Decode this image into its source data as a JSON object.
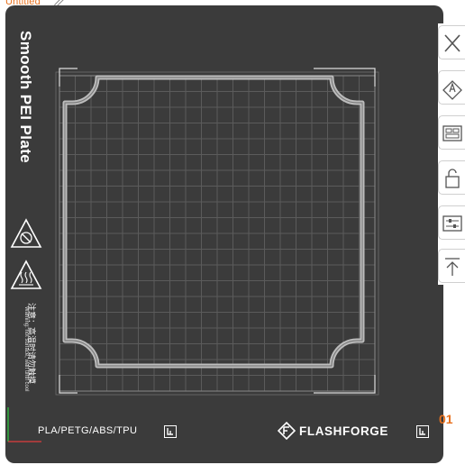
{
  "app": {
    "title": "Untitled"
  },
  "plate": {
    "name": "Smooth PEI Plate",
    "warning_cn": "注意：高温时请勿触摸",
    "warning_en": "Warning: hot surface, wait until cool",
    "materials": "PLA/PETG/ABS/TPU",
    "brand": "FLASHFORGE",
    "number": "01"
  },
  "toolbar": {
    "items": [
      {
        "icon": "close-icon"
      },
      {
        "icon": "auto-orient-icon"
      },
      {
        "icon": "arrange-icon"
      },
      {
        "icon": "lock-icon"
      },
      {
        "icon": "settings-sliders-icon"
      },
      {
        "icon": "move-to-top-icon"
      }
    ]
  },
  "colors": {
    "accent": "#e8711e",
    "bed": "#3b3b3b",
    "grid": "#5a5a5a",
    "toolbar_bg": "#ffffff"
  }
}
